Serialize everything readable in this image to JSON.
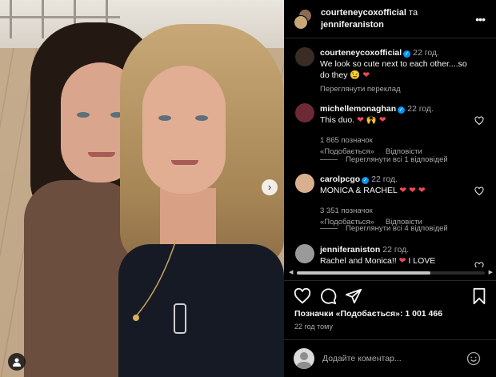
{
  "post": {
    "authors": [
      "courteneycoxofficial",
      "jenniferaniston"
    ],
    "and_word": "та"
  },
  "caption": {
    "user": "courteneycoxofficial",
    "time": "22 год.",
    "text": "We look so cute next to each other....so do they",
    "emoji": "😉",
    "translate": "Переглянути переклад"
  },
  "comments": [
    {
      "user": "michellemonaghan",
      "time": "22 год.",
      "text": "This duo.",
      "emoji": "❤ 🙌 ❤",
      "likes": "1 865 позначок «Подобається»",
      "reply": "Відповісти",
      "view_replies": "Переглянути всі 1 відповідей"
    },
    {
      "user": "carolpcgo",
      "time": "22 год.",
      "text": "MONICA & RACHEL",
      "emoji": "❤ ❤ ❤",
      "likes": "3 351 позначок «Подобається»",
      "reply": "Відповісти",
      "view_replies": "Переглянути всі 4 відповідей"
    },
    {
      "user": "jenniferaniston",
      "time": "22 год.",
      "text": "Rachel and Monica!!",
      "emoji": "❤",
      "text_tail": "I LOVE"
    }
  ],
  "scroll": {
    "thumb_fraction": 0.71
  },
  "icons": [
    "heart-icon",
    "comment-icon",
    "share-icon",
    "bookmark-icon",
    "more-icon",
    "emoji-icon",
    "user-tag-icon",
    "next-arrow-icon"
  ],
  "stats": {
    "likes_label": "Позначки «Подобається»: 1 001 466",
    "posted": "22 год тому"
  },
  "composer": {
    "placeholder": "Додайте коментар..."
  },
  "colors": {
    "background": "#000000",
    "verified": "#0095f6",
    "heart": "#ed4956",
    "muted_text": "#a8a8a8"
  }
}
